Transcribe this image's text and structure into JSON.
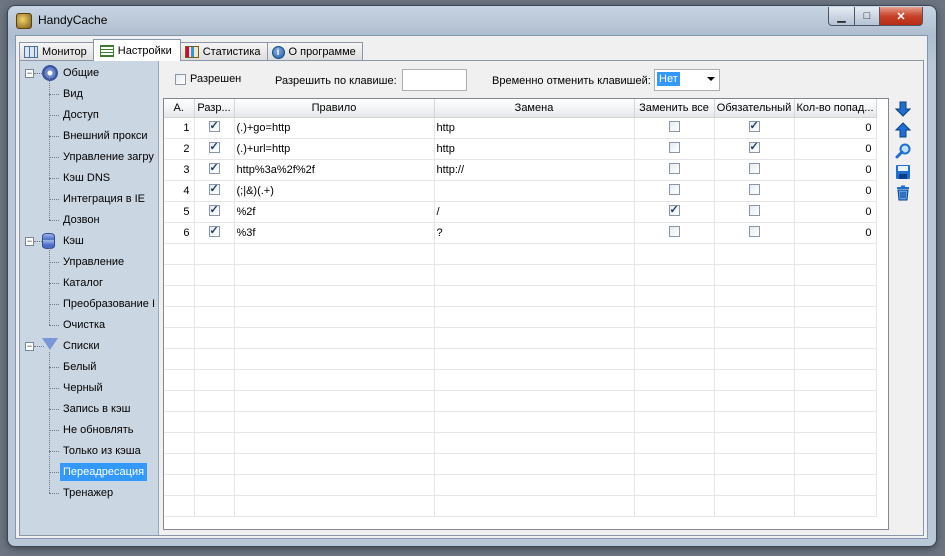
{
  "window": {
    "title": "HandyCache",
    "min_glyph": "▁",
    "max_glyph": "□",
    "close_glyph": "✕"
  },
  "tabs": [
    {
      "label": "Монитор",
      "icon": "monitor-icon"
    },
    {
      "label": "Настройки",
      "icon": "settings-icon",
      "active": true
    },
    {
      "label": "Статистика",
      "icon": "statistics-icon"
    },
    {
      "label": "О программе",
      "icon": "info-icon"
    }
  ],
  "tree": {
    "groups": [
      {
        "label": "Общие",
        "icon": "gear-icon",
        "expander": "−",
        "items": [
          "Вид",
          "Доступ",
          "Внешний прокси",
          "Управление загру",
          "Кэш DNS",
          "Интеграция в IE",
          "Дозвон"
        ]
      },
      {
        "label": "Кэш",
        "icon": "database-icon",
        "expander": "−",
        "items": [
          "Управление",
          "Каталог",
          "Преобразование I",
          "Очистка"
        ]
      },
      {
        "label": "Списки",
        "icon": "filter-icon",
        "expander": "−",
        "items": [
          "Белый",
          "Черный",
          "Запись в кэш",
          "Не обновлять",
          "Только из кэша",
          "Переадресация",
          "Тренажер"
        ]
      }
    ],
    "selected": "Переадресация"
  },
  "toolbar": {
    "enabled_label": "Разрешен",
    "enabled_checked": false,
    "hotkey_label": "Разрешить по клавише:",
    "hotkey_value": "",
    "cancel_label": "Временно отменить клавишей:",
    "cancel_value": "Нет"
  },
  "grid": {
    "columns": [
      "А.",
      "Разр...",
      "Правило",
      "Замена",
      "Заменить все",
      "Обязательный",
      "Кол-во попад..."
    ],
    "rows": [
      {
        "n": "1",
        "enabled": true,
        "rule": "(.)+go=http",
        "replace": "http",
        "replace_all": false,
        "required": true,
        "hits": "0"
      },
      {
        "n": "2",
        "enabled": true,
        "rule": "(.)+url=http",
        "replace": "http",
        "replace_all": false,
        "required": true,
        "hits": "0"
      },
      {
        "n": "3",
        "enabled": true,
        "rule": "http%3a%2f%2f",
        "replace": "http://",
        "replace_all": false,
        "required": false,
        "hits": "0"
      },
      {
        "n": "4",
        "enabled": true,
        "rule": "(;|&)(.+)",
        "replace": "",
        "replace_all": false,
        "required": false,
        "hits": "0"
      },
      {
        "n": "5",
        "enabled": true,
        "rule": "%2f",
        "replace": "/",
        "replace_all": true,
        "required": false,
        "hits": "0"
      },
      {
        "n": "6",
        "enabled": true,
        "rule": "%3f",
        "replace": "?",
        "replace_all": false,
        "required": false,
        "hits": "0"
      }
    ],
    "empty_rows": 13
  },
  "side_buttons": [
    "move-down-icon",
    "move-up-icon",
    "search-icon",
    "save-icon",
    "delete-icon"
  ]
}
